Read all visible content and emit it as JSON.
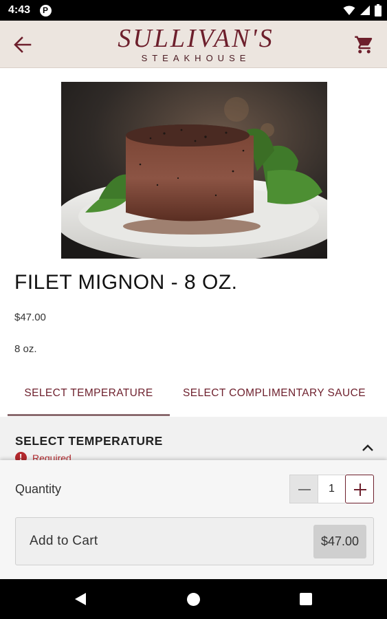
{
  "status_bar": {
    "time": "4:43",
    "icons": [
      "p-notification-icon",
      "wifi-icon",
      "signal-icon",
      "battery-icon"
    ]
  },
  "header": {
    "logo_main": "SULLIVAN'S",
    "logo_sub": "STEAKHOUSE",
    "back_icon": "arrow-left-icon",
    "cart_icon": "shopping-cart-icon",
    "brand_color": "#6d1f2c",
    "background_color": "#ece5df"
  },
  "product": {
    "title": "FILET MIGNON - 8 OZ.",
    "price": "$47.00",
    "description": "8 oz."
  },
  "tabs": [
    {
      "label": "SELECT TEMPERATURE",
      "active": true
    },
    {
      "label": "SELECT COMPLIMENTARY SAUCE",
      "active": false
    }
  ],
  "section": {
    "title": "SELECT TEMPERATURE",
    "required_label": "Required",
    "required_color": "#b3282d",
    "expanded_icon": "chevron-up-icon"
  },
  "order": {
    "quantity_label": "Quantity",
    "quantity": "1",
    "add_to_cart_label": "Add to Cart",
    "total": "$47.00"
  },
  "nav_bar": {
    "icons": [
      "nav-back-icon",
      "nav-home-icon",
      "nav-recents-icon"
    ]
  }
}
